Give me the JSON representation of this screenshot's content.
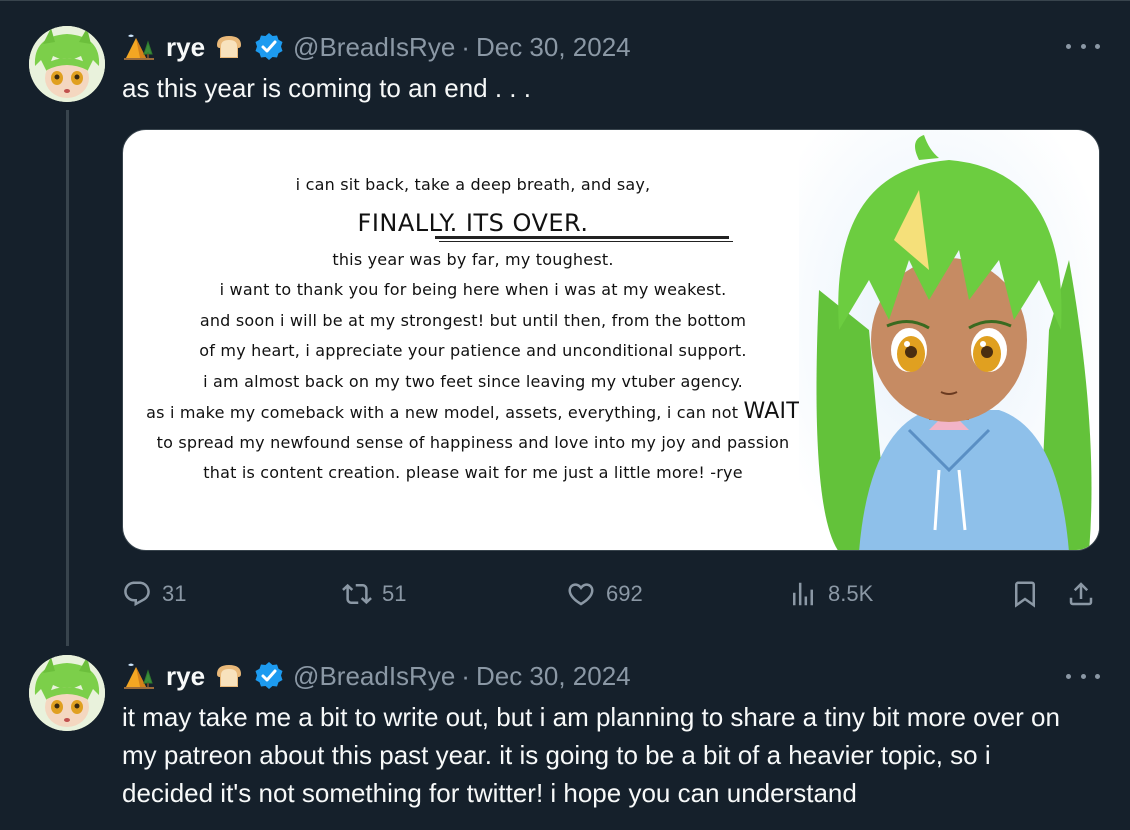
{
  "tweets": [
    {
      "display_name": "rye",
      "prefix_emoji_icon": "camping-icon",
      "suffix_emoji_icon": "bread-icon",
      "verified": true,
      "handle": "@BreadIsRye",
      "separator": "·",
      "date": "Dec 30, 2024",
      "text": "as this year is coming to an end . . .",
      "media": {
        "lines": [
          "i can sit back, take a deep breath, and say,",
          "FINALLY. ITS OVER.",
          "this year was by far, my toughest.",
          "i want to thank you for being here when i was at my weakest.",
          "and soon i will be at my strongest! but until then, from the bottom",
          "of my heart, i appreciate your patience and unconditional support.",
          "i am almost back on my two feet since leaving my vtuber agency.",
          "as i make my comeback with a new model, assets, everything, i can not",
          "to spread my newfound sense of happiness and love into my joy and passion",
          "that is content creation. please wait for me just a little more! -rye"
        ],
        "emphasis_word": "WAIT"
      },
      "stats": {
        "replies": "31",
        "reposts": "51",
        "likes": "692",
        "views": "8.5K"
      }
    },
    {
      "display_name": "rye",
      "prefix_emoji_icon": "camping-icon",
      "suffix_emoji_icon": "bread-icon",
      "verified": true,
      "handle": "@BreadIsRye",
      "separator": "·",
      "date": "Dec 30, 2024",
      "text": "it may take me a bit to write out, but i am planning to share a tiny bit more over on my patreon about this past year. it is going to be a bit of a heavier topic, so i decided it's not something for twitter! i hope you can understand"
    }
  ],
  "colors": {
    "background": "#15202b",
    "text_primary": "#f7f9f9",
    "text_secondary": "#8b98a5",
    "border": "#38444d",
    "verified": "#1d9bf0"
  }
}
